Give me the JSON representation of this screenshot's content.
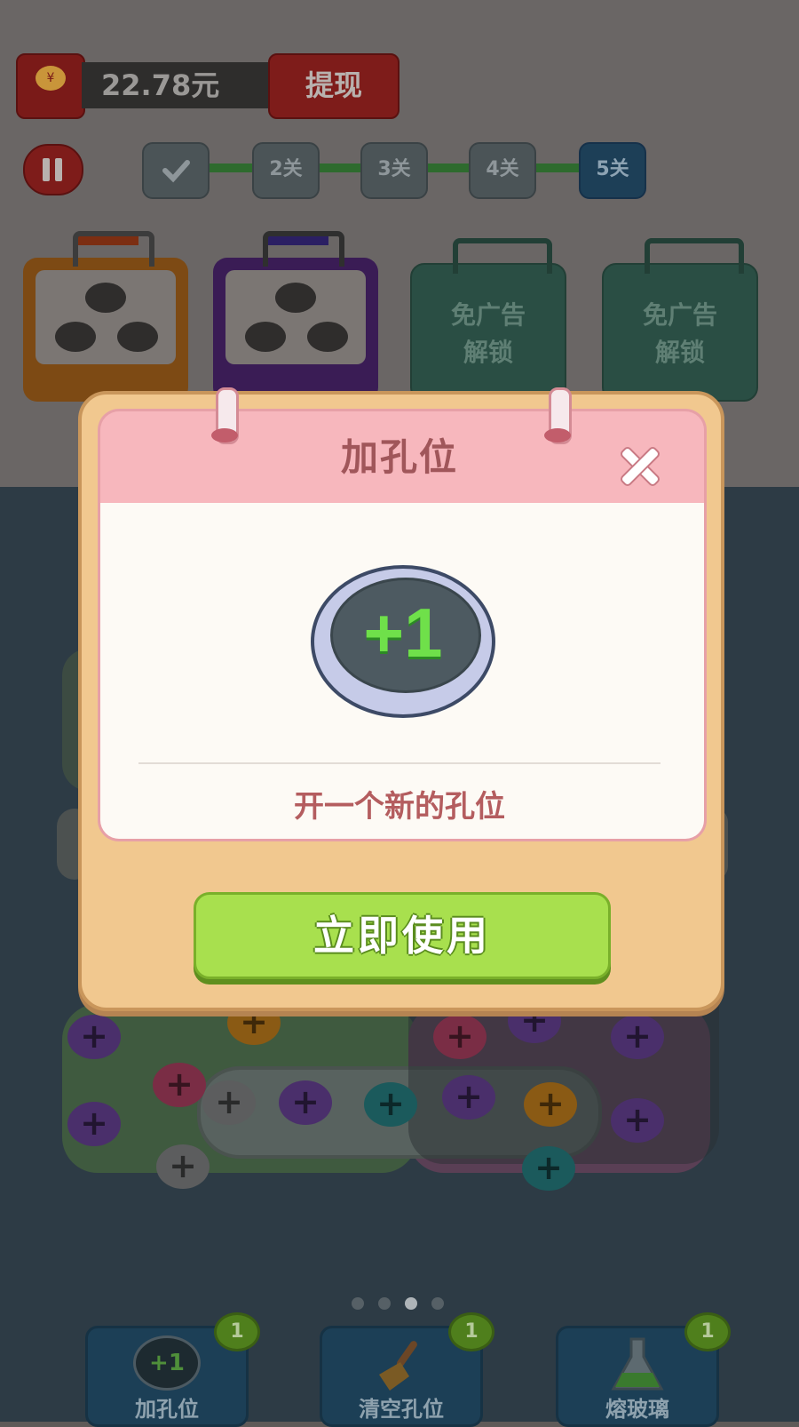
{
  "header": {
    "money_value": "22.78元",
    "withdraw_label": "提现",
    "money_icon_text": "¥"
  },
  "levels": {
    "items": [
      "",
      "2关",
      "3关",
      "4关",
      "5关"
    ],
    "current_index": 4
  },
  "containers": {
    "locked_label_line1": "免广告",
    "locked_label_line2": "解锁"
  },
  "modal": {
    "title": "加孔位",
    "coin_label": "+1",
    "description": "开一个新的孔位",
    "use_button": "立即使用"
  },
  "page_indicator": {
    "count": 4,
    "active": 3
  },
  "tools": [
    {
      "label": "加孔位",
      "count": "1",
      "icon": "plus-one-icon",
      "icon_text": "+1"
    },
    {
      "label": "清空孔位",
      "count": "1",
      "icon": "broom-icon"
    },
    {
      "label": "熔玻璃",
      "count": "1",
      "icon": "flask-icon"
    }
  ],
  "colors": {
    "modal_frame": "#f1c88f",
    "modal_header": "#f7b7bd",
    "button_green": "#a8e04e",
    "coin_green_text": "#6fe04a"
  }
}
